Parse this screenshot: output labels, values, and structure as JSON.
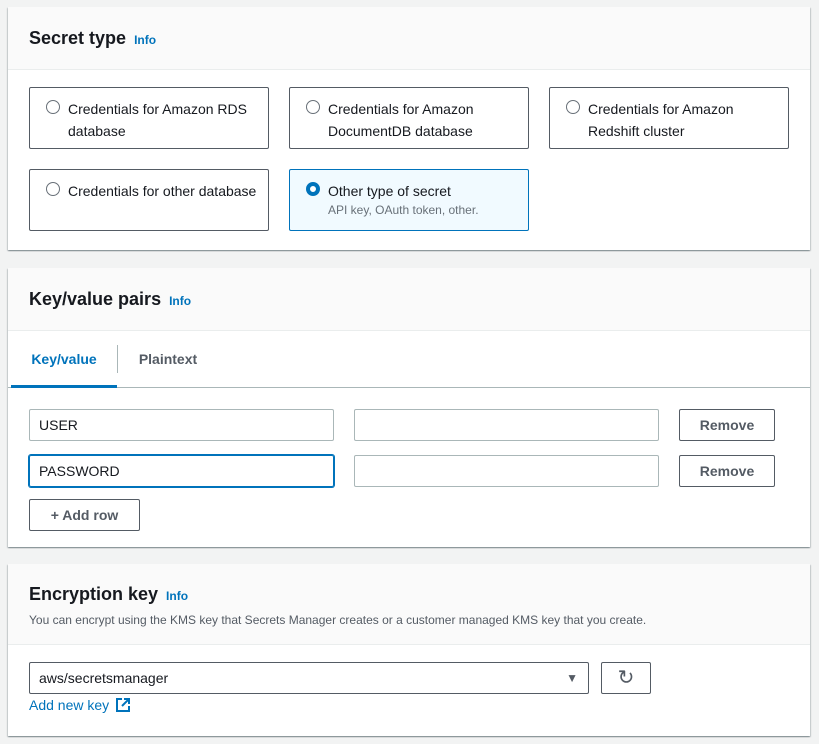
{
  "secret_type": {
    "title": "Secret type",
    "info": "Info",
    "options": [
      {
        "label": "Credentials for Amazon RDS database",
        "selected": false
      },
      {
        "label": "Credentials for Amazon DocumentDB database",
        "selected": false
      },
      {
        "label": "Credentials for Amazon Redshift cluster",
        "selected": false
      },
      {
        "label": "Credentials for other database",
        "selected": false
      },
      {
        "label": "Other type of secret",
        "description": "API key, OAuth token, other.",
        "selected": true
      }
    ]
  },
  "kv": {
    "title": "Key/value pairs",
    "info": "Info",
    "tabs": [
      {
        "label": "Key/value",
        "active": true
      },
      {
        "label": "Plaintext",
        "active": false
      }
    ],
    "rows": [
      {
        "key": "USER",
        "value": "",
        "remove": "Remove"
      },
      {
        "key": "PASSWORD",
        "value": "",
        "remove": "Remove"
      }
    ],
    "add_row": "+ Add row"
  },
  "encryption": {
    "title": "Encryption key",
    "info": "Info",
    "description": "You can encrypt using the KMS key that Secrets Manager creates or a customer managed KMS key that you create.",
    "selected_key": "aws/secretsmanager",
    "add_new_key": "Add new key"
  },
  "colors": {
    "accent": "#0073bb",
    "background": "#f2f3f3"
  }
}
